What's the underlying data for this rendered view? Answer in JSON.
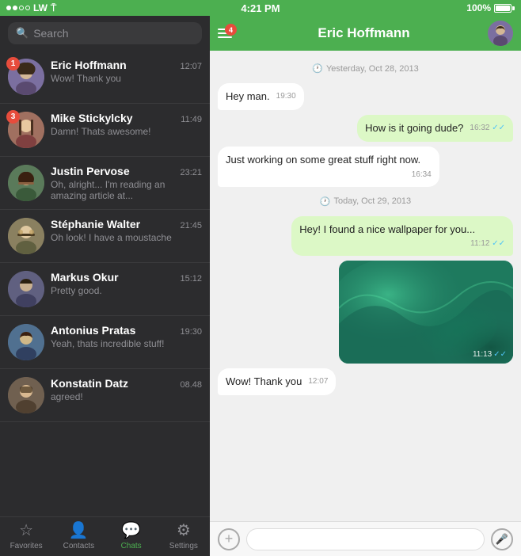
{
  "statusBar": {
    "signal": [
      "filled",
      "filled",
      "empty",
      "empty"
    ],
    "carrier": "LW",
    "wifi": true,
    "time": "4:21 PM",
    "battery": "100%"
  },
  "search": {
    "placeholder": "Search"
  },
  "chats": [
    {
      "id": 1,
      "name": "Eric Hoffmann",
      "time": "12:07",
      "preview": "Wow! Thank you",
      "badge": 1,
      "avatarColor": "#7b6fa0"
    },
    {
      "id": 2,
      "name": "Mike Stickylcky",
      "time": "11:49",
      "preview": "Damn! Thats awesome!",
      "badge": 3,
      "avatarColor": "#a07060"
    },
    {
      "id": 3,
      "name": "Justin Pervose",
      "time": "23:21",
      "preview": "Oh, alright... I'm reading an amazing article at...",
      "badge": 0,
      "avatarColor": "#5a7a5a"
    },
    {
      "id": 4,
      "name": "Stéphanie Walter",
      "time": "21:45",
      "preview": "Oh look! I have a moustache",
      "badge": 0,
      "avatarColor": "#8a8060"
    },
    {
      "id": 5,
      "name": "Markus Okur",
      "time": "15:12",
      "preview": "Pretty good.",
      "badge": 0,
      "avatarColor": "#606080"
    },
    {
      "id": 6,
      "name": "Antonius Pratas",
      "time": "19:30",
      "preview": "Yeah, thats incredible stuff!",
      "badge": 0,
      "avatarColor": "#507090"
    },
    {
      "id": 7,
      "name": "Konstatin Datz",
      "time": "08.48",
      "preview": "agreed!",
      "badge": 0,
      "avatarColor": "#706050"
    }
  ],
  "activeChat": {
    "name": "Eric Hoffmann",
    "headerBadge": 4
  },
  "messages": [
    {
      "id": 1,
      "type": "date",
      "text": "Yesterday, Oct 28, 2013"
    },
    {
      "id": 2,
      "type": "incoming",
      "text": "Hey man.",
      "time": "19:30"
    },
    {
      "id": 3,
      "type": "outgoing",
      "text": "How is it going dude?",
      "time": "16:32",
      "delivered": true
    },
    {
      "id": 4,
      "type": "incoming",
      "text": "Just working on some great stuff right now.",
      "time": "16:34"
    },
    {
      "id": 5,
      "type": "date",
      "text": "Today, Oct 29, 2013"
    },
    {
      "id": 6,
      "type": "outgoing",
      "text": "Hey! I found a nice wallpaper for you...",
      "time": "11:12",
      "delivered": true
    },
    {
      "id": 7,
      "type": "image",
      "time": "11:13",
      "delivered": true
    },
    {
      "id": 8,
      "type": "incoming",
      "text": "Wow! Thank you",
      "time": "12:07"
    }
  ],
  "messageInput": {
    "placeholder": ""
  },
  "tabs": [
    {
      "id": "favorites",
      "label": "Favorites",
      "icon": "★",
      "active": false
    },
    {
      "id": "contacts",
      "label": "Contacts",
      "icon": "👤",
      "active": false
    },
    {
      "id": "chats",
      "label": "Chats",
      "icon": "💬",
      "active": true
    },
    {
      "id": "settings",
      "label": "Settings",
      "icon": "⚙",
      "active": false
    }
  ]
}
